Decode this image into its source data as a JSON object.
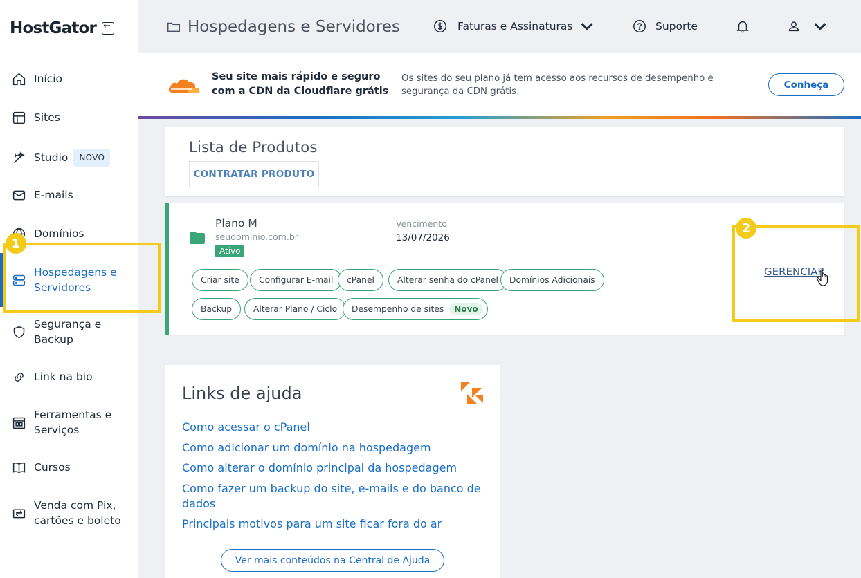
{
  "brand": {
    "name": "HostGator"
  },
  "sidebar": {
    "items": [
      {
        "label": "Início",
        "icon": "home-icon"
      },
      {
        "label": "Sites",
        "icon": "browser-icon"
      },
      {
        "label": "Studio",
        "icon": "magic-wand-icon",
        "badge": "NOVO"
      },
      {
        "label": "E-mails",
        "icon": "envelope-icon"
      },
      {
        "label": "Domínios",
        "icon": "globe-icon"
      },
      {
        "label": "Hospedagens e Servidores",
        "line1": "Hospedagens e",
        "line2": "Servidores",
        "icon": "server-icon",
        "active": true
      },
      {
        "label": "Segurança e Backup",
        "line1": "Segurança e",
        "line2": "Backup",
        "icon": "shield-icon"
      },
      {
        "label": "Link na bio",
        "icon": "link-icon"
      },
      {
        "label": "Ferramentas e Serviços",
        "line1": "Ferramentas e",
        "line2": "Serviços",
        "icon": "tools-icon"
      },
      {
        "label": "Cursos",
        "icon": "book-icon"
      },
      {
        "label": "Venda com Pix, cartões e boleto",
        "line1": "Venda com Pix,",
        "line2": "cartões e boleto",
        "icon": "payment-icon"
      }
    ]
  },
  "header": {
    "breadcrumb": "Hospedagens e Servidores",
    "billing": "Faturas e Assinaturas",
    "support": "Suporte"
  },
  "banner": {
    "title": "Seu site mais rápido e seguro com a CDN da Cloudflare grátis",
    "description": "Os sites do seu plano já tem acesso aos recursos de desempenho e segurança da CDN grátis.",
    "button": "Conheça"
  },
  "products": {
    "title": "Lista de Produtos",
    "add_button": "CONTRATAR PRODUTO",
    "plan": {
      "name": "Plano M",
      "domain": "seudominio.com.br",
      "status": "Ativo",
      "due_label": "Vencimento",
      "due_date": "13/07/2026",
      "manage": "GERENCIAR",
      "actions": [
        "Criar site",
        "Configurar E-mail",
        "cPanel",
        "Alterar senha do cPanel",
        "Domínios Adicionais",
        "Backup",
        "Alterar Plano / Ciclo",
        "Desempenho de sites"
      ],
      "new_badge": "Novo"
    }
  },
  "help": {
    "title": "Links de ajuda",
    "links": [
      "Como acessar o cPanel",
      "Como adicionar um domínio na hospedagem",
      "Como alterar o domínio principal da hospedagem",
      "Como fazer um backup do site, e-mails e do banco de dados",
      "Principais motivos para um site ficar fora do ar"
    ],
    "more_button": "Ver mais conteúdos na Central de Ajuda"
  },
  "annotations": {
    "step1": "1",
    "step2": "2"
  },
  "colors": {
    "accent": "#1a6fc4",
    "success": "#3aa677",
    "highlight": "#f3cc1a"
  }
}
